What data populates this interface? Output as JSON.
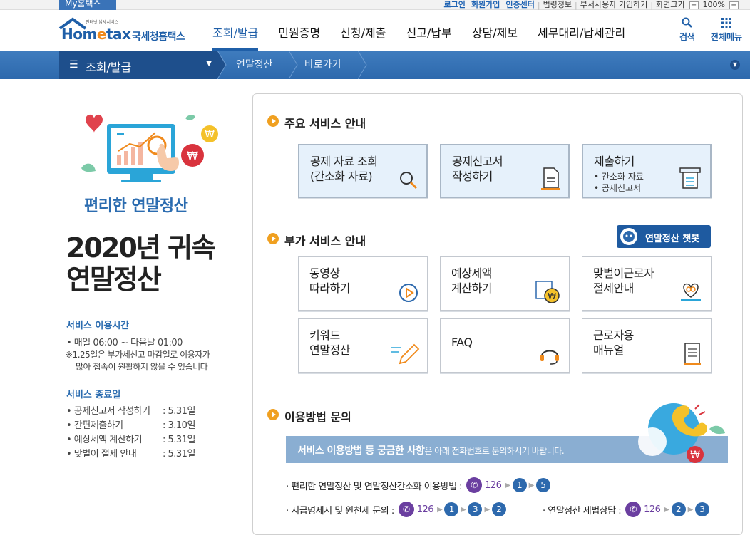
{
  "util": {
    "mytab": "My홈택스",
    "links": [
      "로그인",
      "회원가입",
      "인증센터",
      "법령정보",
      "부서사용자 가입하기",
      "화면크기"
    ],
    "zoom_minus": "−",
    "zoom": "100%",
    "zoom_plus": "+"
  },
  "header": {
    "logo_sub": "인터넷 납세서비스",
    "logo_brand_a": "Hom",
    "logo_brand_e": "e",
    "logo_brand_b": "tax",
    "logo_name": "국세청홈택스",
    "menu": [
      "조회/발급",
      "민원증명",
      "신청/제출",
      "신고/납부",
      "상담/제보",
      "세무대리/납세관리"
    ],
    "search_label": "검색",
    "allmenu_label": "전체메뉴"
  },
  "crumb": {
    "menu_label": "조회/발급",
    "items": [
      "연말정산",
      "바로가기"
    ]
  },
  "left": {
    "tagline": "편리한 연말정산",
    "title_line1": "2020년 귀속",
    "title_line2": "연말정산",
    "hours_title": "서비스 이용시간",
    "hours_item": "• 매일 06:00 ~ 다음날 01:00",
    "hours_note_1": "※1.25일은 부가세신고 마감일로 이용자가",
    "hours_note_2": "많아 접속이 원활하지 않을 수 있습니다",
    "end_title": "서비스 종료일",
    "end_rows": [
      {
        "label": "• 공제신고서 작성하기",
        "date": ": 5.31일"
      },
      {
        "label": "• 간편제출하기",
        "date": ": 3.10일"
      },
      {
        "label": "• 예상세액 계산하기",
        "date": ": 5.31일"
      },
      {
        "label": "• 맞벌이 절세 안내",
        "date": ": 5.31일"
      }
    ]
  },
  "main": {
    "section1": "주요 서비스 안내",
    "main_services": [
      {
        "line1": "공제 자료 조회",
        "line2": "(간소화 자료)"
      },
      {
        "line1": "공제신고서",
        "line2": "작성하기"
      },
      {
        "line1": "제출하기",
        "sub1": "• 간소화 자료",
        "sub2": "• 공제신고서"
      }
    ],
    "section2": "부가 서비스 안내",
    "chatbot_label": "연말정산 챗봇",
    "extra_services": [
      {
        "line1": "동영상",
        "line2": "따라하기"
      },
      {
        "line1": "예상세액",
        "line2": "계산하기"
      },
      {
        "line1": "맞벌이근로자",
        "line2": "절세안내"
      },
      {
        "line1": "키워드",
        "line2": "연말정산"
      },
      {
        "line1": "FAQ",
        "line2": ""
      },
      {
        "line1": "근로자용",
        "line2": "매뉴얼"
      }
    ],
    "section3": "이용방법 문의",
    "banner_bold": "서비스 이용방법 등 궁금한 사항",
    "banner_rest": "은 아래 전화번호로 문의하시기 바랍니다.",
    "phone1_label": "· 편리한 연말정산 및 연말정산간소화 이용방법 :",
    "phone2_label": "· 지급명세서 및 원천세 문의 :",
    "phone3_label": "· 연말정산 세법상담 :",
    "phone_number": "126",
    "phone1_steps": [
      "1",
      "5"
    ],
    "phone2_steps": [
      "1",
      "3",
      "2"
    ],
    "phone3_steps": [
      "2",
      "3"
    ]
  }
}
